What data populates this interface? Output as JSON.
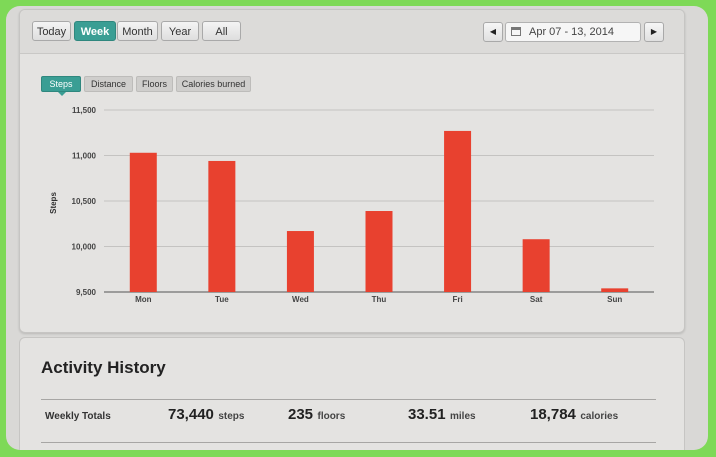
{
  "toolbar": {
    "ranges": [
      "Today",
      "Week",
      "Month",
      "Year",
      "All"
    ],
    "active_range": "Week",
    "date_range": "Apr 07 - 13, 2014",
    "prev_icon": "triangle-left",
    "next_icon": "triangle-right",
    "calendar_icon": "calendar"
  },
  "metrics": {
    "tabs": [
      "Steps",
      "Distance",
      "Floors",
      "Calories burned"
    ],
    "active": "Steps"
  },
  "colors": {
    "accent": "#3a9e94",
    "bar": "#e8412f"
  },
  "chart_data": {
    "type": "bar",
    "categories": [
      "Mon",
      "Tue",
      "Wed",
      "Thu",
      "Fri",
      "Sat",
      "Sun"
    ],
    "series": [
      {
        "values": [
          11030,
          10940,
          10170,
          10390,
          11270,
          10080,
          9540
        ]
      }
    ],
    "ylabel": "Steps",
    "ylim": [
      9500,
      11500
    ],
    "yticks": [
      9500,
      10000,
      10500,
      11000,
      11500
    ],
    "ytick_labels": [
      "9,500",
      "10,000",
      "10,500",
      "11,000",
      "11,500"
    ],
    "grid": true
  },
  "activity": {
    "title": "Activity History",
    "totals_label": "Weekly Totals",
    "totals": [
      {
        "value": "73,440",
        "unit": "steps"
      },
      {
        "value": "235",
        "unit": "floors"
      },
      {
        "value": "33.51",
        "unit": "miles"
      },
      {
        "value": "18,784",
        "unit": "calories"
      }
    ]
  }
}
